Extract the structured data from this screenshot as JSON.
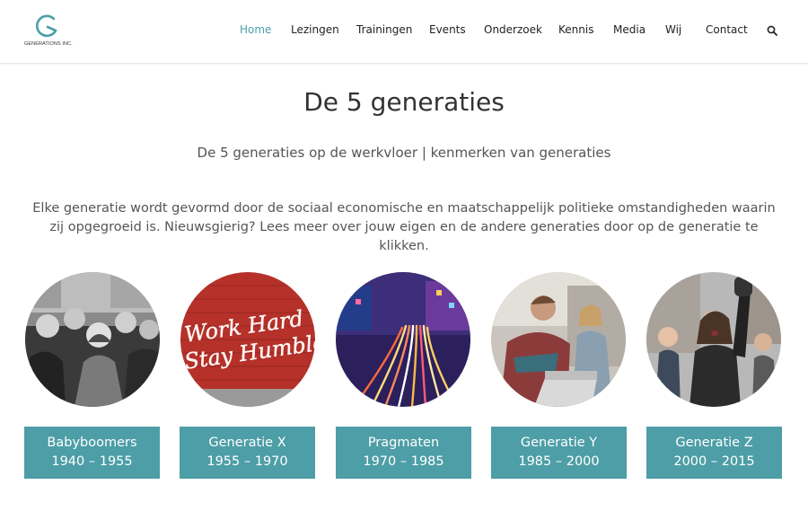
{
  "brand": {
    "logo_text": "GENERATIONS INC.",
    "accent_color": "#4a9eaa"
  },
  "nav": {
    "items": [
      {
        "label": "Home",
        "active": true
      },
      {
        "label": "Lezingen"
      },
      {
        "label": "Trainingen"
      },
      {
        "label": "Events"
      },
      {
        "label": "Onderzoek"
      },
      {
        "label": "Kennis"
      },
      {
        "label": "Media"
      },
      {
        "label": "Wij"
      },
      {
        "label": "Contact"
      }
    ],
    "search_icon": "search-icon"
  },
  "page": {
    "title": "De 5 generaties",
    "subtitle": "De 5 generaties op de werkvloer | kenmerken van generaties",
    "intro": "Elke generatie wordt gevormd door de sociaal economische en maatschappelijk politieke omstandigheden waarin zij opgegroeid is. Nieuwsgierig? Lees meer over jouw eigen en de andere generaties door op de generatie te klikken."
  },
  "generations": [
    {
      "name": "Babyboomers",
      "years": "1940 – 1955",
      "image": "black-and-white crowd photo"
    },
    {
      "name": "Generatie X",
      "years": "1955 – 1970",
      "image": "neon sign work hard stay humble",
      "sign_text": "Work Hard Stay Humble"
    },
    {
      "name": "Pragmaten",
      "years": "1970 – 1985",
      "image": "city light trails at night"
    },
    {
      "name": "Generatie Y",
      "years": "1985 – 2000",
      "image": "young people with laptop"
    },
    {
      "name": "Generatie Z",
      "years": "2000 – 2015",
      "image": "young protesters"
    }
  ],
  "colors": {
    "button_bg": "#4d9ea6",
    "button_text": "#ffffff"
  }
}
